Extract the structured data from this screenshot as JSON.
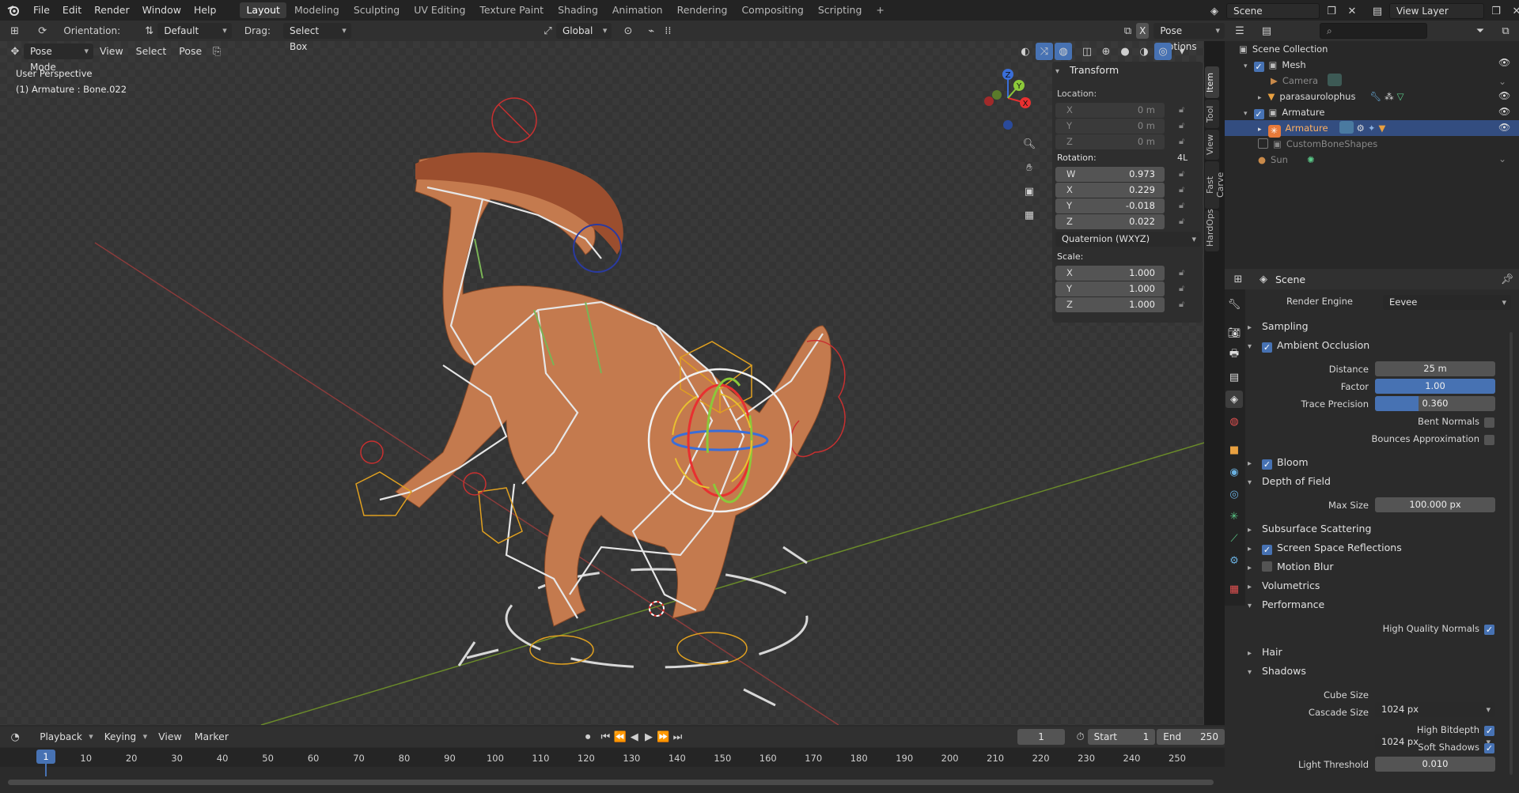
{
  "topbar": {
    "menus": [
      "File",
      "Edit",
      "Render",
      "Window",
      "Help"
    ],
    "workspaces": [
      "Layout",
      "Modeling",
      "Sculpting",
      "UV Editing",
      "Texture Paint",
      "Shading",
      "Animation",
      "Rendering",
      "Compositing",
      "Scripting"
    ],
    "add_tab": "+",
    "scene": "Scene",
    "view_layer": "View Layer"
  },
  "viewport_header": {
    "orientation_label": "Orientation:",
    "orientation_value": "Default",
    "drag_label": "Drag:",
    "drag_value": "Select Box",
    "transform_orientation": "Global",
    "close_x": "X",
    "pose_options": "Pose Options",
    "mode": "Pose Mode",
    "menus": [
      "View",
      "Select",
      "Pose"
    ]
  },
  "viewport": {
    "perspective": "User Perspective",
    "active_object": "(1) Armature : Bone.022",
    "gizmo_axes": [
      "Z",
      "Y",
      "X"
    ]
  },
  "npanel": {
    "title": "Transform",
    "location_label": "Location:",
    "location": [
      {
        "k": "X",
        "v": "0 m"
      },
      {
        "k": "Y",
        "v": "0 m"
      },
      {
        "k": "Z",
        "v": "0 m"
      }
    ],
    "rotation_label": "Rotation:",
    "rotation_mode_short": "4L",
    "rotation": [
      {
        "k": "W",
        "v": "0.973"
      },
      {
        "k": "X",
        "v": "0.229"
      },
      {
        "k": "Y",
        "v": "-0.018"
      },
      {
        "k": "Z",
        "v": "0.022"
      }
    ],
    "rotation_mode": "Quaternion (WXYZ)",
    "scale_label": "Scale:",
    "scale": [
      {
        "k": "X",
        "v": "1.000"
      },
      {
        "k": "Y",
        "v": "1.000"
      },
      {
        "k": "Z",
        "v": "1.000"
      }
    ],
    "tabs": [
      "Item",
      "Tool",
      "View",
      "Fast Carve",
      "HardOps"
    ]
  },
  "outliner": {
    "search_placeholder": "",
    "items": [
      {
        "name": "Scene Collection"
      },
      {
        "name": "Mesh"
      },
      {
        "name": "Camera"
      },
      {
        "name": "parasaurolophus"
      },
      {
        "name": "Armature"
      },
      {
        "name": "Armature"
      },
      {
        "name": "CustomBoneShapes"
      },
      {
        "name": "Sun"
      }
    ]
  },
  "properties": {
    "context": "Scene",
    "render_engine_label": "Render Engine",
    "render_engine": "Eevee",
    "sections": {
      "sampling": "Sampling",
      "ao": "Ambient Occlusion",
      "bloom": "Bloom",
      "dof": "Depth of Field",
      "sss": "Subsurface Scattering",
      "ssr": "Screen Space Reflections",
      "motion_blur": "Motion Blur",
      "volumetrics": "Volumetrics",
      "performance": "Performance",
      "hair": "Hair",
      "shadows": "Shadows"
    },
    "ao": {
      "distance_label": "Distance",
      "distance": "25 m",
      "factor_label": "Factor",
      "factor": "1.00",
      "factor_fraction": 1.0,
      "trace_label": "Trace Precision",
      "trace": "0.360",
      "trace_fraction": 0.36,
      "bent_label": "Bent Normals",
      "bounces_label": "Bounces Approximation"
    },
    "dof": {
      "max_size_label": "Max Size",
      "max_size": "100.000 px"
    },
    "performance": {
      "hq_normals_label": "High Quality Normals"
    },
    "shadows": {
      "cube_label": "Cube Size",
      "cube": "1024 px",
      "cascade_label": "Cascade Size",
      "cascade": "1024 px",
      "bitdepth_label": "High Bitdepth",
      "soft_label": "Soft Shadows",
      "threshold_label": "Light Threshold",
      "threshold": "0.010"
    }
  },
  "timeline": {
    "menus": [
      "Playback",
      "Keying",
      "View",
      "Marker"
    ],
    "current_frame": "1",
    "start_label": "Start",
    "start": "1",
    "end_label": "End",
    "end": "250",
    "cursor_frame": "1",
    "ticks": [
      "10",
      "20",
      "30",
      "40",
      "50",
      "60",
      "70",
      "80",
      "90",
      "100",
      "110",
      "120",
      "130",
      "140",
      "150",
      "160",
      "170",
      "180",
      "190",
      "200",
      "210",
      "220",
      "230",
      "240",
      "250"
    ]
  }
}
